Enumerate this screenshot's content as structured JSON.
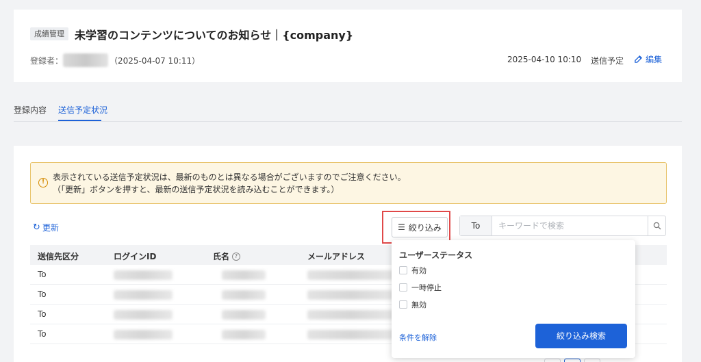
{
  "header": {
    "category": "成績管理",
    "title": "未学習のコンテンツについてのお知らせ｜{company}",
    "registrant_label": "登録者：",
    "registered_at": "（2025-04-07 10:11）",
    "scheduled_at": "2025-04-10 10:10",
    "scheduled_status": "送信予定",
    "edit_label": "編集"
  },
  "tabs": [
    {
      "label": "登録内容"
    },
    {
      "label": "送信予定状況"
    }
  ],
  "notice": {
    "line1": "表示されている送信予定状況は、最新のものとは異なる場合がございますのでご注意ください。",
    "line2": "（「更新」ボタンを押すと、最新の送信予定状況を読み込むことができます。）"
  },
  "toolbar": {
    "refresh_label": "更新",
    "filter_label": "絞り込み",
    "search_scope": "To",
    "search_placeholder": "キーワードで検索"
  },
  "table": {
    "columns": [
      "送信先区分",
      "ログインID",
      "氏名",
      "メールアドレス"
    ],
    "rows": [
      {
        "type": "To"
      },
      {
        "type": "To"
      },
      {
        "type": "To"
      },
      {
        "type": "To"
      }
    ]
  },
  "filter_dropdown": {
    "title": "ユーザーステータス",
    "options": [
      "有効",
      "一時停止",
      "無効"
    ],
    "clear_label": "条件を解除",
    "search_label": "絞り込み検索"
  },
  "icons": {
    "edit": "edit-icon",
    "refresh": "refresh-icon",
    "filter": "sliders-icon",
    "search": "search-icon",
    "warning": "exclamation-circle-icon",
    "help": "question-circle-icon"
  },
  "colors": {
    "accent": "#1d62d8",
    "notice_bg": "#fdf6e3",
    "notice_border": "#e8c36a",
    "highlight": "#e04848"
  }
}
